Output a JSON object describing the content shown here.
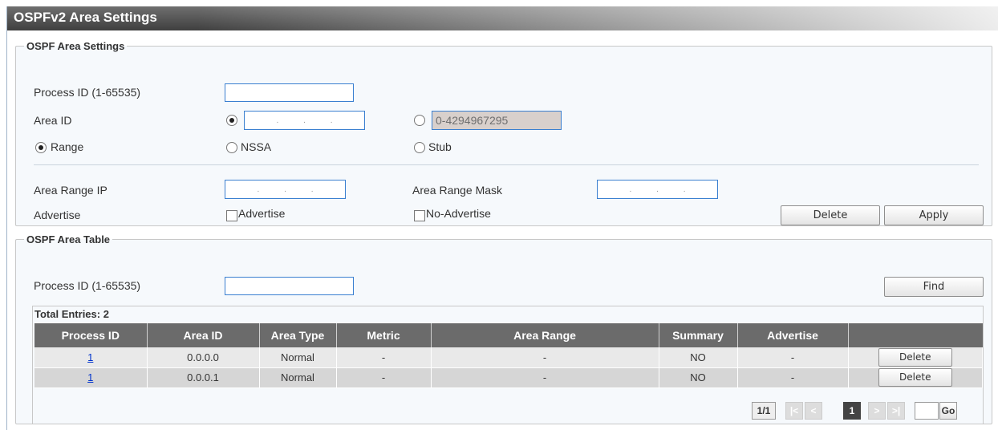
{
  "title": "OSPFv2 Area Settings",
  "area_settings": {
    "legend": "OSPF Area Settings",
    "process_id_label": "Process ID (1-65535)",
    "process_id_value": "",
    "area_id_label": "Area ID",
    "area_id_ip_dots": ".  .  .",
    "area_id_number_value": "0-4294967295",
    "range_label": "Range",
    "nssa_label": "NSSA",
    "stub_label": "Stub",
    "area_range_ip_label": "Area Range IP",
    "area_range_mask_label": "Area Range Mask",
    "advertise_label": "Advertise",
    "advertise_option": "Advertise",
    "no_advertise_option": "No-Advertise",
    "delete_button": "Delete",
    "apply_button": "Apply"
  },
  "area_table": {
    "legend": "OSPF Area Table",
    "process_id_label": "Process ID (1-65535)",
    "find_button": "Find",
    "total_entries": "Total Entries: 2",
    "columns": [
      "Process ID",
      "Area ID",
      "Area Type",
      "Metric",
      "Area Range",
      "Summary",
      "Advertise",
      ""
    ],
    "rows": [
      {
        "process_id": "1",
        "area_id": "0.0.0.0",
        "area_type": "Normal",
        "metric": "-",
        "area_range": "-",
        "summary": "NO",
        "advertise": "-",
        "action": "Delete"
      },
      {
        "process_id": "1",
        "area_id": "0.0.0.1",
        "area_type": "Normal",
        "metric": "-",
        "area_range": "-",
        "summary": "NO",
        "advertise": "-",
        "action": "Delete"
      }
    ],
    "pagination": {
      "page_info": "1/1",
      "first": "|<",
      "prev": "<",
      "current": "1",
      "next": ">",
      "last": ">|",
      "go_button": "Go"
    }
  }
}
